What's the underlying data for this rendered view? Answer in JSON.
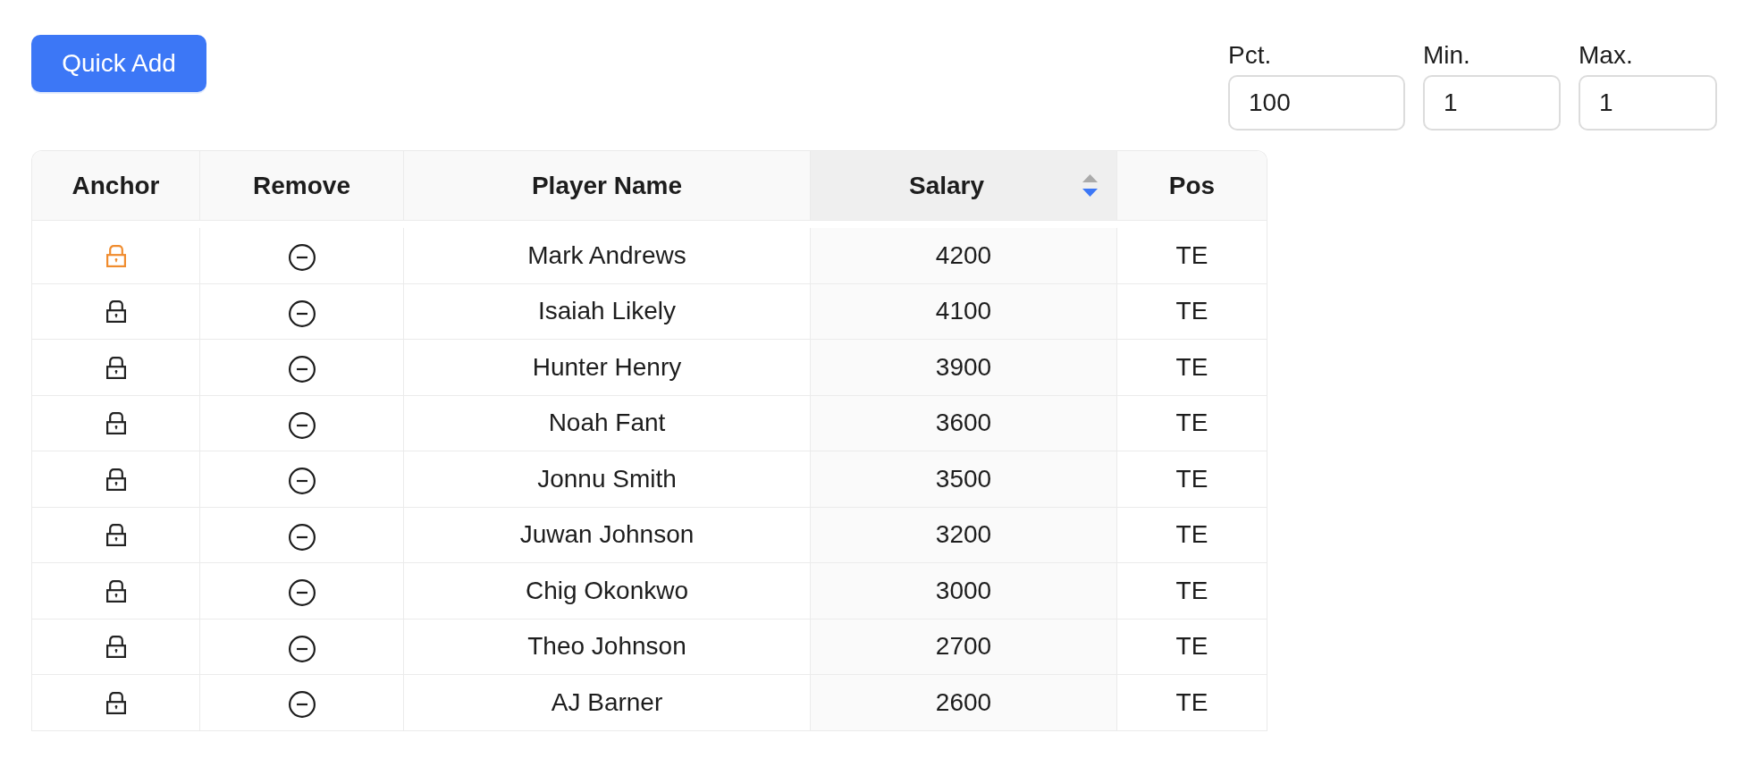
{
  "toolbar": {
    "quick_add": "Quick Add"
  },
  "filters": [
    {
      "label": "Pct.",
      "value": "100"
    },
    {
      "label": "Min.",
      "value": "1"
    },
    {
      "label": "Max.",
      "value": "1"
    }
  ],
  "table": {
    "columns": [
      {
        "label": "Anchor",
        "kind": "anchor",
        "sorted": false
      },
      {
        "label": "Remove",
        "kind": "remove",
        "sorted": false
      },
      {
        "label": "Player Name",
        "kind": "name",
        "sorted": false
      },
      {
        "label": "Salary",
        "kind": "salary",
        "sorted": true,
        "descending": true
      },
      {
        "label": "Pos",
        "kind": "pos",
        "sorted": false
      }
    ],
    "rows": [
      {
        "anchored": true,
        "name": "Mark Andrews",
        "salary": "4200",
        "pos": "TE"
      },
      {
        "anchored": false,
        "name": "Isaiah Likely",
        "salary": "4100",
        "pos": "TE"
      },
      {
        "anchored": false,
        "name": "Hunter Henry",
        "salary": "3900",
        "pos": "TE"
      },
      {
        "anchored": false,
        "name": "Noah Fant",
        "salary": "3600",
        "pos": "TE"
      },
      {
        "anchored": false,
        "name": "Jonnu Smith",
        "salary": "3500",
        "pos": "TE"
      },
      {
        "anchored": false,
        "name": "Juwan Johnson",
        "salary": "3200",
        "pos": "TE"
      },
      {
        "anchored": false,
        "name": "Chig Okonkwo",
        "salary": "3000",
        "pos": "TE"
      },
      {
        "anchored": false,
        "name": "Theo Johnson",
        "salary": "2700",
        "pos": "TE"
      },
      {
        "anchored": false,
        "name": "AJ Barner",
        "salary": "2600",
        "pos": "TE"
      }
    ]
  }
}
